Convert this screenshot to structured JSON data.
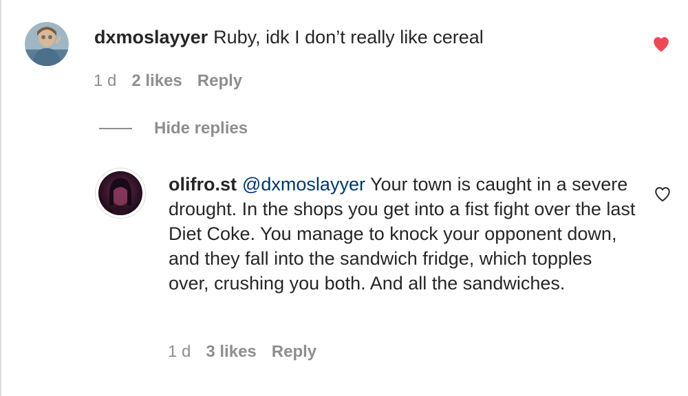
{
  "comment": {
    "username": "dxmoslayyer",
    "text": "Ruby, idk I don’t really like cereal",
    "time": "1 d",
    "likes": "2 likes",
    "reply_label": "Reply",
    "liked": true,
    "like_icon": "heart-filled-icon",
    "like_color": "#ed4956"
  },
  "replies_toggle": {
    "label": "Hide replies"
  },
  "reply": {
    "username": "olifro.st",
    "mention": "@dxmoslayyer",
    "text": "Your town is caught in a severe drought. In the shops you get into a fist fight over the last Diet Coke. You manage to knock your opponent down, and they fall into the sandwich fridge, which topples over, crushing you both. And all the sandwiches.",
    "time": "1 d",
    "likes": "3 likes",
    "reply_label": "Reply",
    "liked": false,
    "like_icon": "heart-outline-icon"
  }
}
